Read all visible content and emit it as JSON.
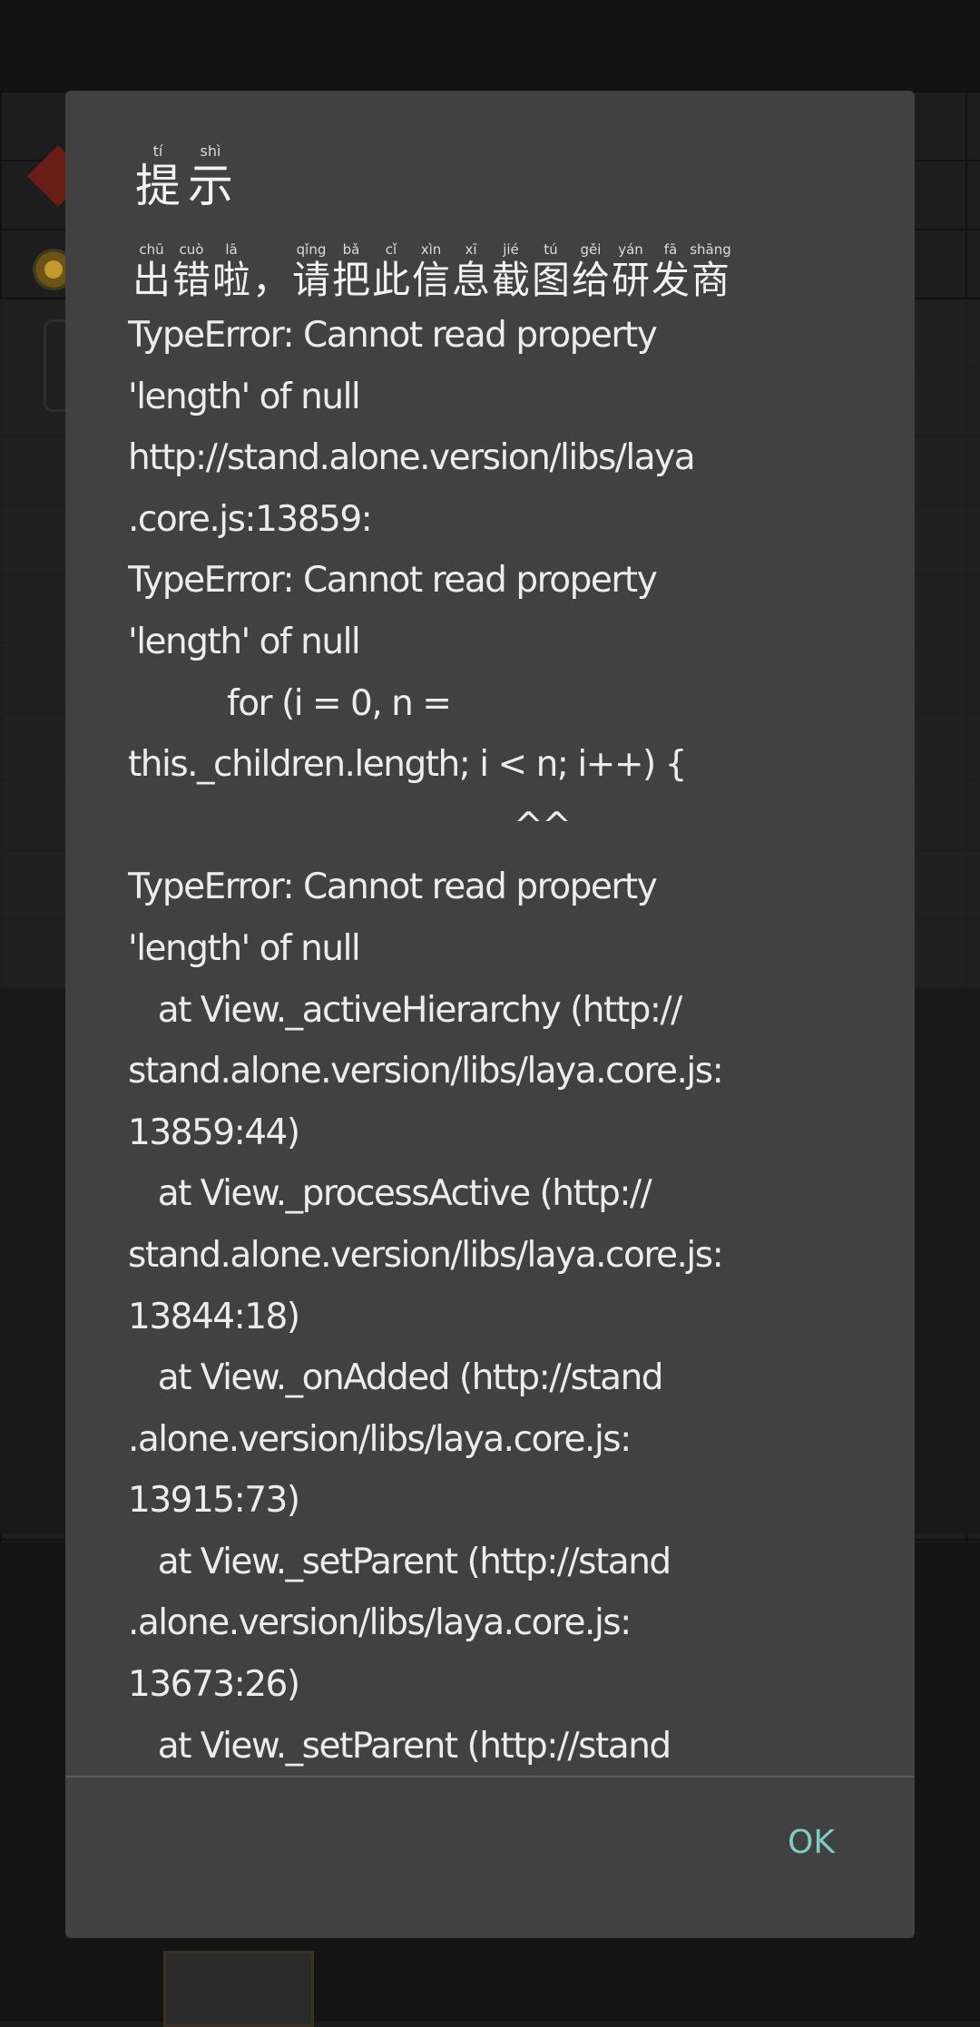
{
  "dialog": {
    "title_chars": [
      {
        "py": "tí",
        "hz": "提"
      },
      {
        "py": "shì",
        "hz": "示"
      }
    ],
    "message_chars": [
      {
        "py": "chū",
        "hz": "出"
      },
      {
        "py": "cuò",
        "hz": "错"
      },
      {
        "py": "lā",
        "hz": "啦"
      },
      {
        "py": "",
        "hz": "，"
      },
      {
        "py": "qǐng",
        "hz": "请"
      },
      {
        "py": "bǎ",
        "hz": "把"
      },
      {
        "py": "cǐ",
        "hz": "此"
      },
      {
        "py": "xìn",
        "hz": "信"
      },
      {
        "py": "xī",
        "hz": "息"
      },
      {
        "py": "jié",
        "hz": "截"
      },
      {
        "py": "tú",
        "hz": "图"
      },
      {
        "py": "gěi",
        "hz": "给"
      },
      {
        "py": "yán",
        "hz": "研"
      },
      {
        "py": "fā",
        "hz": "发"
      },
      {
        "py": "shāng",
        "hz": "商"
      }
    ],
    "error_lines": [
      "TypeError: Cannot read property",
      "'length' of null",
      "http://stand.alone.version/libs/laya",
      ".core.js:13859:",
      "TypeError: Cannot read property",
      "'length' of null",
      "          for (i = 0, n =",
      "this._children.length; i < n; i++) {",
      "                                       ^^",
      "TypeError: Cannot read property",
      "'length' of null",
      "   at View._activeHierarchy (http://",
      "stand.alone.version/libs/laya.core.js:",
      "13859:44)",
      "   at View._processActive (http://",
      "stand.alone.version/libs/laya.core.js:",
      "13844:18)",
      "   at View._onAdded (http://stand",
      ".alone.version/libs/laya.core.js:",
      "13915:73)",
      "   at View._setParent (http://stand",
      ".alone.version/libs/laya.core.js:",
      "13673:26)",
      "   at View._setParent (http://stand"
    ],
    "ok_label": "OK",
    "ok_color": "#80cbc4",
    "background_color": "#414141"
  }
}
